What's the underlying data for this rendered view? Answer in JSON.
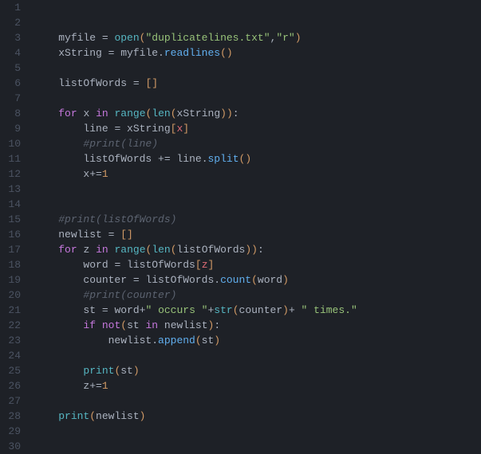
{
  "lines": [
    {
      "num": "1",
      "tokens": []
    },
    {
      "num": "2",
      "tokens": []
    },
    {
      "num": "3",
      "tokens": [
        {
          "t": "    ",
          "c": "c-def"
        },
        {
          "t": "myfile",
          "c": "c-def"
        },
        {
          "t": " = ",
          "c": "c-op"
        },
        {
          "t": "open",
          "c": "c-fn"
        },
        {
          "t": "(",
          "c": "c-br"
        },
        {
          "t": "\"duplicatelines.txt\"",
          "c": "c-str"
        },
        {
          "t": ",",
          "c": "c-pun"
        },
        {
          "t": "\"r\"",
          "c": "c-str"
        },
        {
          "t": ")",
          "c": "c-br"
        }
      ]
    },
    {
      "num": "4",
      "tokens": [
        {
          "t": "    ",
          "c": "c-def"
        },
        {
          "t": "xString",
          "c": "c-def"
        },
        {
          "t": " = ",
          "c": "c-op"
        },
        {
          "t": "myfile",
          "c": "c-def"
        },
        {
          "t": ".",
          "c": "c-pun"
        },
        {
          "t": "readlines",
          "c": "c-blue"
        },
        {
          "t": "()",
          "c": "c-br"
        }
      ]
    },
    {
      "num": "5",
      "tokens": []
    },
    {
      "num": "6",
      "tokens": [
        {
          "t": "    ",
          "c": "c-def"
        },
        {
          "t": "listOfWords",
          "c": "c-def"
        },
        {
          "t": " = ",
          "c": "c-op"
        },
        {
          "t": "[]",
          "c": "c-br"
        }
      ]
    },
    {
      "num": "7",
      "tokens": []
    },
    {
      "num": "8",
      "tokens": [
        {
          "t": "    ",
          "c": "c-def"
        },
        {
          "t": "for",
          "c": "c-kw"
        },
        {
          "t": " ",
          "c": "c-def"
        },
        {
          "t": "x",
          "c": "c-def"
        },
        {
          "t": " ",
          "c": "c-def"
        },
        {
          "t": "in",
          "c": "c-kw"
        },
        {
          "t": " ",
          "c": "c-def"
        },
        {
          "t": "range",
          "c": "c-fn"
        },
        {
          "t": "(",
          "c": "c-br"
        },
        {
          "t": "len",
          "c": "c-fn"
        },
        {
          "t": "(",
          "c": "c-br"
        },
        {
          "t": "xString",
          "c": "c-def"
        },
        {
          "t": "))",
          "c": "c-br"
        },
        {
          "t": ":",
          "c": "c-pun"
        }
      ]
    },
    {
      "num": "9",
      "tokens": [
        {
          "t": "        ",
          "c": "c-def"
        },
        {
          "t": "line",
          "c": "c-def"
        },
        {
          "t": " = ",
          "c": "c-op"
        },
        {
          "t": "xString",
          "c": "c-def"
        },
        {
          "t": "[",
          "c": "c-br"
        },
        {
          "t": "x",
          "c": "c-var"
        },
        {
          "t": "]",
          "c": "c-br"
        }
      ]
    },
    {
      "num": "10",
      "tokens": [
        {
          "t": "        ",
          "c": "c-def"
        },
        {
          "t": "#print(line)",
          "c": "c-cmt"
        }
      ]
    },
    {
      "num": "11",
      "tokens": [
        {
          "t": "        ",
          "c": "c-def"
        },
        {
          "t": "listOfWords",
          "c": "c-def"
        },
        {
          "t": " += ",
          "c": "c-op"
        },
        {
          "t": "line",
          "c": "c-def"
        },
        {
          "t": ".",
          "c": "c-pun"
        },
        {
          "t": "split",
          "c": "c-blue"
        },
        {
          "t": "()",
          "c": "c-br"
        }
      ]
    },
    {
      "num": "12",
      "tokens": [
        {
          "t": "        ",
          "c": "c-def"
        },
        {
          "t": "x",
          "c": "c-def"
        },
        {
          "t": "+=",
          "c": "c-op"
        },
        {
          "t": "1",
          "c": "c-num"
        }
      ]
    },
    {
      "num": "13",
      "tokens": []
    },
    {
      "num": "14",
      "tokens": []
    },
    {
      "num": "15",
      "tokens": [
        {
          "t": "    ",
          "c": "c-def"
        },
        {
          "t": "#print(listOfWords)",
          "c": "c-cmt"
        }
      ]
    },
    {
      "num": "16",
      "tokens": [
        {
          "t": "    ",
          "c": "c-def"
        },
        {
          "t": "newlist",
          "c": "c-def"
        },
        {
          "t": " = ",
          "c": "c-op"
        },
        {
          "t": "[]",
          "c": "c-br"
        }
      ]
    },
    {
      "num": "17",
      "tokens": [
        {
          "t": "    ",
          "c": "c-def"
        },
        {
          "t": "for",
          "c": "c-kw"
        },
        {
          "t": " ",
          "c": "c-def"
        },
        {
          "t": "z",
          "c": "c-def"
        },
        {
          "t": " ",
          "c": "c-def"
        },
        {
          "t": "in",
          "c": "c-kw"
        },
        {
          "t": " ",
          "c": "c-def"
        },
        {
          "t": "range",
          "c": "c-fn"
        },
        {
          "t": "(",
          "c": "c-br"
        },
        {
          "t": "len",
          "c": "c-fn"
        },
        {
          "t": "(",
          "c": "c-br"
        },
        {
          "t": "listOfWords",
          "c": "c-def"
        },
        {
          "t": "))",
          "c": "c-br"
        },
        {
          "t": ":",
          "c": "c-pun"
        }
      ]
    },
    {
      "num": "18",
      "tokens": [
        {
          "t": "        ",
          "c": "c-def"
        },
        {
          "t": "word",
          "c": "c-def"
        },
        {
          "t": " = ",
          "c": "c-op"
        },
        {
          "t": "listOfWords",
          "c": "c-def"
        },
        {
          "t": "[",
          "c": "c-br"
        },
        {
          "t": "z",
          "c": "c-var"
        },
        {
          "t": "]",
          "c": "c-br"
        }
      ]
    },
    {
      "num": "19",
      "tokens": [
        {
          "t": "        ",
          "c": "c-def"
        },
        {
          "t": "counter",
          "c": "c-def"
        },
        {
          "t": " = ",
          "c": "c-op"
        },
        {
          "t": "listOfWords",
          "c": "c-def"
        },
        {
          "t": ".",
          "c": "c-pun"
        },
        {
          "t": "count",
          "c": "c-blue"
        },
        {
          "t": "(",
          "c": "c-br"
        },
        {
          "t": "word",
          "c": "c-def"
        },
        {
          "t": ")",
          "c": "c-br"
        }
      ]
    },
    {
      "num": "20",
      "tokens": [
        {
          "t": "        ",
          "c": "c-def"
        },
        {
          "t": "#print(counter)",
          "c": "c-cmt"
        }
      ]
    },
    {
      "num": "21",
      "tokens": [
        {
          "t": "        ",
          "c": "c-def"
        },
        {
          "t": "st",
          "c": "c-def"
        },
        {
          "t": " = ",
          "c": "c-op"
        },
        {
          "t": "word",
          "c": "c-def"
        },
        {
          "t": "+",
          "c": "c-op"
        },
        {
          "t": "\" occurs \"",
          "c": "c-str"
        },
        {
          "t": "+",
          "c": "c-op"
        },
        {
          "t": "str",
          "c": "c-fn"
        },
        {
          "t": "(",
          "c": "c-br"
        },
        {
          "t": "counter",
          "c": "c-def"
        },
        {
          "t": ")",
          "c": "c-br"
        },
        {
          "t": "+ ",
          "c": "c-op"
        },
        {
          "t": "\" times.\"",
          "c": "c-str"
        }
      ]
    },
    {
      "num": "22",
      "tokens": [
        {
          "t": "        ",
          "c": "c-def"
        },
        {
          "t": "if",
          "c": "c-kw"
        },
        {
          "t": " ",
          "c": "c-def"
        },
        {
          "t": "not",
          "c": "c-kw"
        },
        {
          "t": "(",
          "c": "c-br"
        },
        {
          "t": "st",
          "c": "c-def"
        },
        {
          "t": " ",
          "c": "c-def"
        },
        {
          "t": "in",
          "c": "c-kw"
        },
        {
          "t": " ",
          "c": "c-def"
        },
        {
          "t": "newlist",
          "c": "c-def"
        },
        {
          "t": ")",
          "c": "c-br"
        },
        {
          "t": ":",
          "c": "c-pun"
        }
      ]
    },
    {
      "num": "23",
      "tokens": [
        {
          "t": "            ",
          "c": "c-def"
        },
        {
          "t": "newlist",
          "c": "c-def"
        },
        {
          "t": ".",
          "c": "c-pun"
        },
        {
          "t": "append",
          "c": "c-blue"
        },
        {
          "t": "(",
          "c": "c-br"
        },
        {
          "t": "st",
          "c": "c-def"
        },
        {
          "t": ")",
          "c": "c-br"
        }
      ]
    },
    {
      "num": "24",
      "tokens": []
    },
    {
      "num": "25",
      "tokens": [
        {
          "t": "        ",
          "c": "c-def"
        },
        {
          "t": "print",
          "c": "c-fn"
        },
        {
          "t": "(",
          "c": "c-br"
        },
        {
          "t": "st",
          "c": "c-def"
        },
        {
          "t": ")",
          "c": "c-br"
        }
      ]
    },
    {
      "num": "26",
      "tokens": [
        {
          "t": "        ",
          "c": "c-def"
        },
        {
          "t": "z",
          "c": "c-def"
        },
        {
          "t": "+=",
          "c": "c-op"
        },
        {
          "t": "1",
          "c": "c-num"
        }
      ]
    },
    {
      "num": "27",
      "tokens": []
    },
    {
      "num": "28",
      "tokens": [
        {
          "t": "    ",
          "c": "c-def"
        },
        {
          "t": "print",
          "c": "c-fn"
        },
        {
          "t": "(",
          "c": "c-br"
        },
        {
          "t": "newlist",
          "c": "c-def"
        },
        {
          "t": ")",
          "c": "c-br"
        }
      ]
    },
    {
      "num": "29",
      "tokens": []
    },
    {
      "num": "30",
      "tokens": []
    }
  ]
}
